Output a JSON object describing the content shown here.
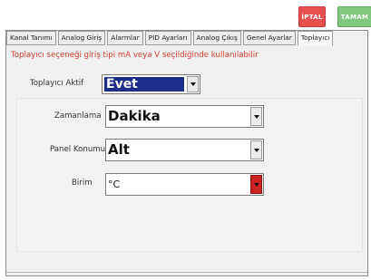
{
  "header": {
    "cancel_label": "İPTAL",
    "ok_label": "TAMAM",
    "cancel_color": "#e7504f",
    "ok_color": "#82c77f"
  },
  "tabs": [
    {
      "label": "Kanal Tanımı"
    },
    {
      "label": "Analog Giriş"
    },
    {
      "label": "Alarmlar"
    },
    {
      "label": "PID Ayarları"
    },
    {
      "label": "Analog Çıkış"
    },
    {
      "label": "Genel Ayarlar"
    },
    {
      "label": "Toplayıcı",
      "active": true
    }
  ],
  "info_text": "Toplayıcı seçeneği giriş tipi mA veya V seçildiğinde kullanılabilir",
  "fields": {
    "aktif": {
      "label": "Toplayıcı Aktif",
      "value": "Evet"
    },
    "zamanlama": {
      "label": "Zamanlama",
      "value": "Dakika"
    },
    "panel": {
      "label": "Panel Konumu",
      "value": "Alt"
    },
    "birim": {
      "label": "Birim",
      "value": "°C"
    }
  },
  "icons": {
    "dropdown": "chevron-down-icon"
  }
}
